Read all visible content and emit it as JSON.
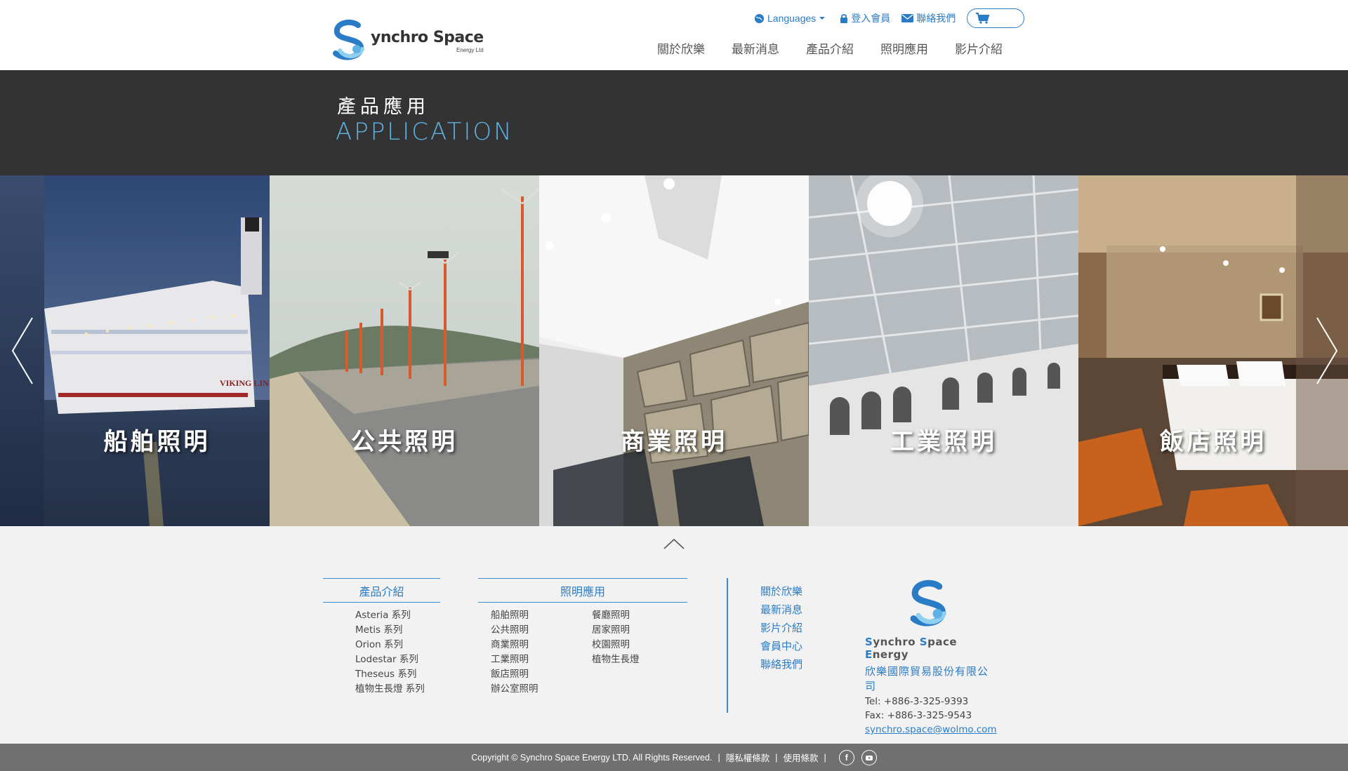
{
  "header": {
    "logo_name": "ynchro Space",
    "logo_sub": "Energy Ltd",
    "topbar": {
      "languages": "Languages",
      "login": "登入會員",
      "contact": "聯絡我們"
    },
    "nav": [
      "關於欣樂",
      "最新消息",
      "產品介紹",
      "照明應用",
      "影片介紹"
    ]
  },
  "banner": {
    "title_zh": "產品應用",
    "title_en": "APPLICATION"
  },
  "gallery": {
    "panels": [
      {
        "caption": "船舶照明"
      },
      {
        "caption": "公共照明"
      },
      {
        "caption": "商業照明"
      },
      {
        "caption": "工業照明"
      },
      {
        "caption": "飯店照明"
      }
    ]
  },
  "footer": {
    "products_title": "產品介紹",
    "products": [
      "Asteria 系列",
      "Metis 系列",
      "Orion 系列",
      "Lodestar 系列",
      "Theseus 系列",
      "植物生長燈 系列"
    ],
    "apps_title": "照明應用",
    "apps_col1": [
      "船舶照明",
      "公共照明",
      "商業照明",
      "工業照明",
      "飯店照明",
      "辦公室照明"
    ],
    "apps_col2": [
      "餐廳照明",
      "居家照明",
      "校園照明",
      "植物生長燈"
    ],
    "quick_links": [
      "關於欣樂",
      "最新消息",
      "影片介紹",
      "會員中心",
      "聯絡我們"
    ],
    "company": {
      "brand_s1": "S",
      "brand_w1": "ynchro ",
      "brand_s2": "S",
      "brand_w2": "pace ",
      "brand_s3": "E",
      "brand_w3": "nergy",
      "name_zh": "欣樂國際貿易股份有限公司",
      "tel": "Tel: +886-3-325-9393",
      "fax": "Fax: +886-3-325-9543",
      "email": "synchro.space@wolmo.com"
    },
    "copyright": "Copyright © Synchro Space Energy LTD. All Rights Reserved.",
    "privacy": "隱私權條款",
    "terms": "使用條款",
    "sep": "|"
  }
}
